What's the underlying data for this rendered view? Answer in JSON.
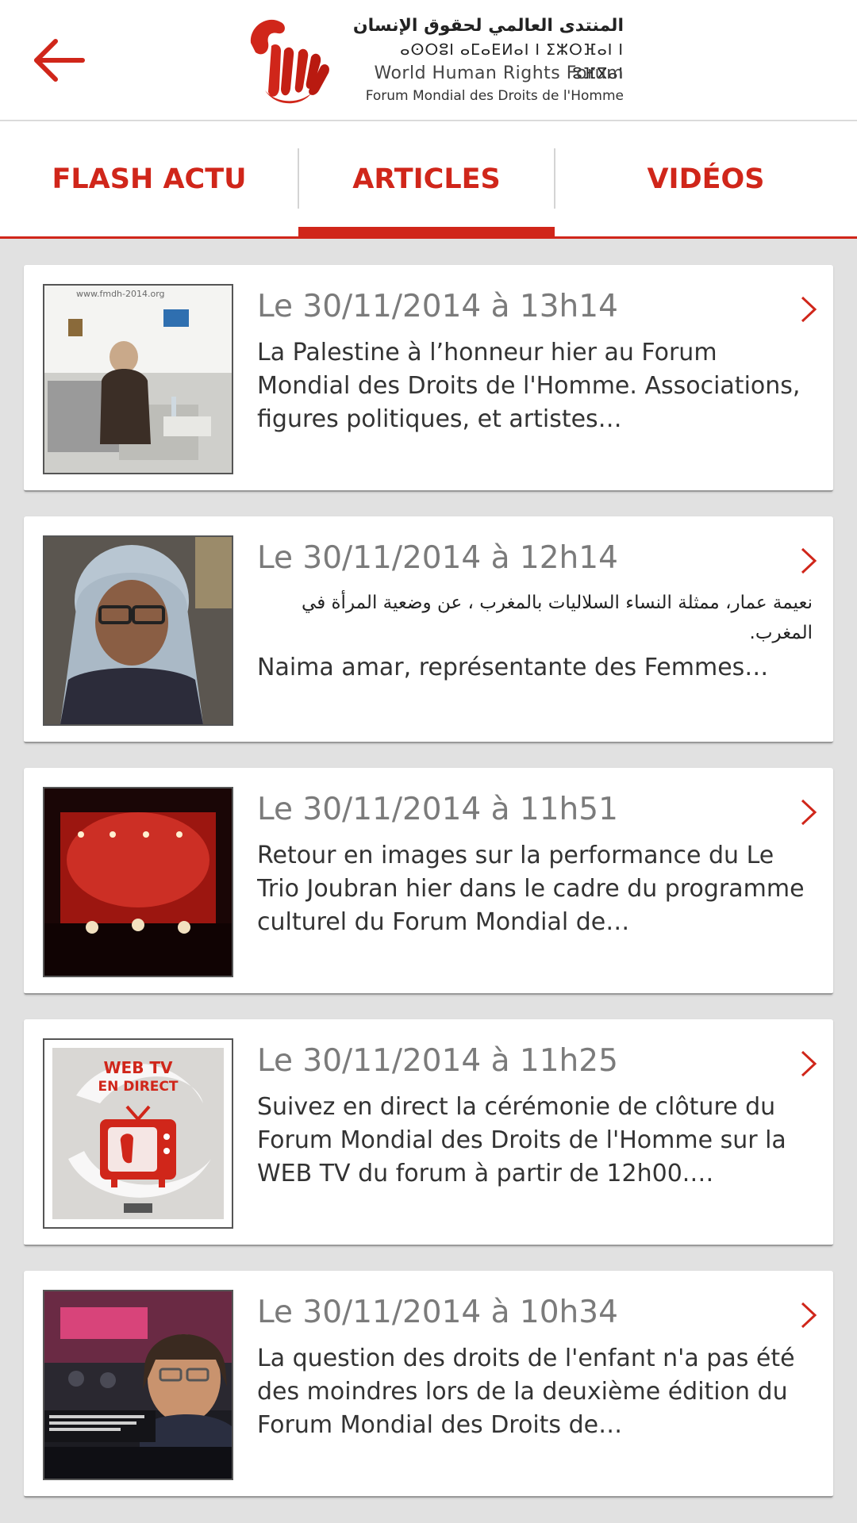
{
  "header": {
    "back_icon": "arrow-left-icon",
    "logo": {
      "arabic": "المنتدى العالمي لحقوق الإنسان",
      "tifinagh": "ⴰⵙⵔⵓⵏ ⴰⵎⴰⴹⵍⴰⵏ ⵏ ⵉⵣⵔⴼⴰⵏ ⵏ ⵓⴼⴳⴰⵏ",
      "english": "World Human Rights Forum",
      "french": "Forum Mondial des Droits de l'Homme"
    },
    "accent_color": "#d0261a"
  },
  "tabs": [
    {
      "label": "FLASH ACTU"
    },
    {
      "label": "ARTICLES"
    },
    {
      "label": "VIDÉOS"
    }
  ],
  "active_tab": "ARTICLES",
  "articles": [
    {
      "date": "Le 30/11/2014 à 13h14",
      "text": "La Palestine à l’honneur hier au Forum Mondial des Droits de l'Homme. Associations, figures politiques, et artistes…",
      "thumb_text": "www.fmdh-2014.org"
    },
    {
      "date": "Le 30/11/2014 à 12h14",
      "text_ar": "نعيمة عمار، ممثلة النساء السلاليات بالمغرب ، عن وضعية المرأة في المغرب.",
      "text": "Naima amar, représentante des Femmes…"
    },
    {
      "date": "Le 30/11/2014 à 11h51",
      "text": "Retour en images sur la performance du Le Trio Joubran hier dans le cadre du programme culturel du Forum Mondial de…"
    },
    {
      "date": "Le 30/11/2014 à 11h25",
      "text": "Suivez en direct la cérémonie de clôture du Forum Mondial des Droits de l'Homme sur la WEB TV du forum à partir de 12h00.…",
      "thumb_title_1": "WEB TV",
      "thumb_title_2": "EN DIRECT"
    },
    {
      "date": "Le 30/11/2014 à 10h34",
      "text": "La question des droits de l'enfant n'a pas été des moindres lors de la deuxième édition du Forum Mondial des Droits de…"
    }
  ]
}
